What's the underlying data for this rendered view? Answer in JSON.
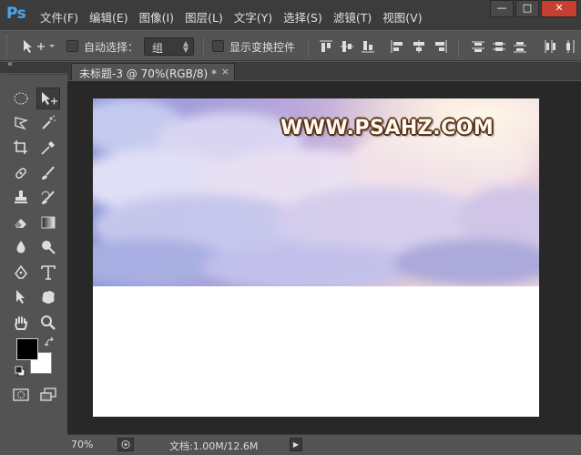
{
  "app": {
    "logo": "Ps"
  },
  "menu": [
    "文件(F)",
    "编辑(E)",
    "图像(I)",
    "图层(L)",
    "文字(Y)",
    "选择(S)",
    "滤镜(T)",
    "视图(V)"
  ],
  "window_controls": {
    "minimize": "—",
    "maximize": "□",
    "close": "✕"
  },
  "options_bar": {
    "auto_select_label": "自动选择：",
    "auto_select_target": "组",
    "show_transform_label": "显示变换控件",
    "auto_select_checked": false,
    "show_transform_checked": false
  },
  "toolbox": {
    "collapse_glyph": "«",
    "tools": [
      "marquee-icon",
      "move-icon",
      "lasso-icon",
      "magic-wand-icon",
      "crop-icon",
      "eyedropper-icon",
      "healing-brush-icon",
      "brush-icon",
      "clone-stamp-icon",
      "history-brush-icon",
      "eraser-icon",
      "gradient-icon",
      "blur-icon",
      "dodge-icon",
      "pen-icon",
      "type-icon",
      "path-selection-icon",
      "custom-shape-icon",
      "hand-icon",
      "zoom-icon",
      "quick-mask-icon",
      "screen-mode-icon"
    ],
    "foreground_color": "#000000",
    "background_color": "#ffffff"
  },
  "document": {
    "tab_title": "未标题-3 @ 70%(RGB/8) *",
    "tab_close": "×",
    "watermark_text": "WWW.PSAHZ.COM"
  },
  "statusbar": {
    "zoom": "70%",
    "doc_info": "文档:1.00M/12.6M",
    "arrow": "▶"
  }
}
